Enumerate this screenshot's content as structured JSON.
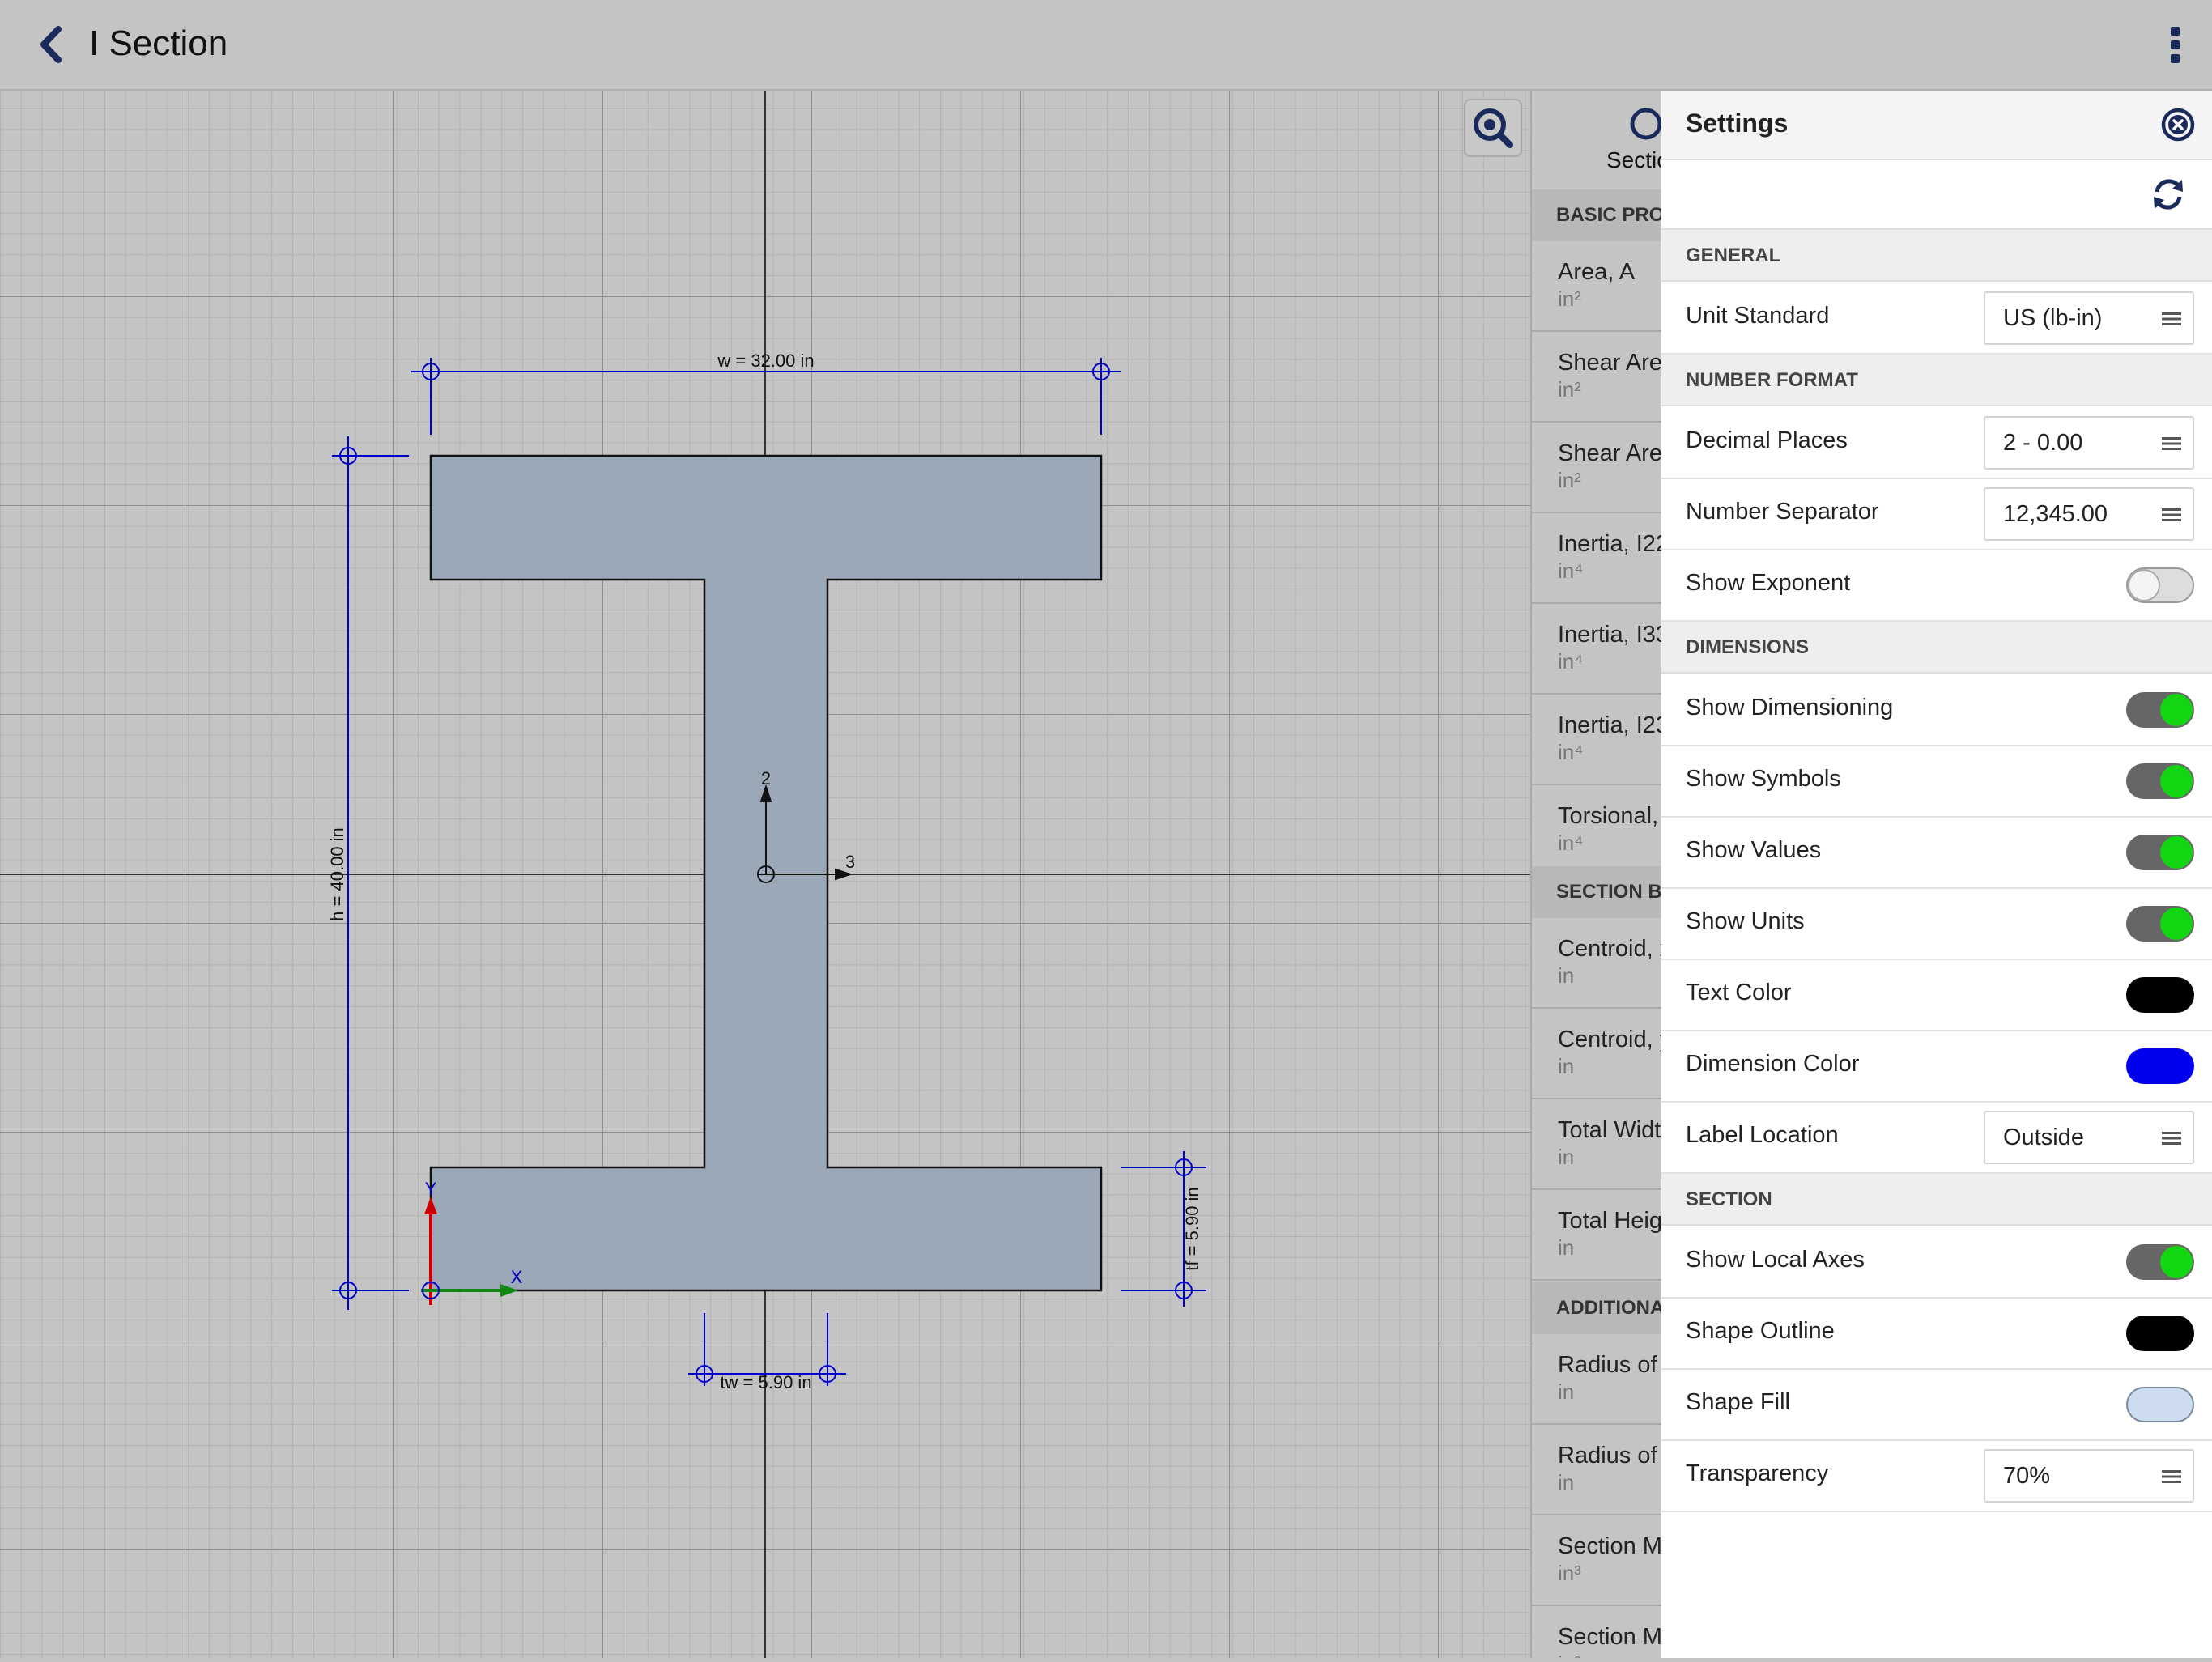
{
  "header": {
    "title": "I Section"
  },
  "section": {
    "w_label": "w = 32.00 in",
    "h_label": "h = 40.00 in",
    "tw_label": "tw = 5.90 in",
    "tf_label": "tf = 5.90 in",
    "axis_x": "X",
    "axis_y": "Y",
    "axis_2": "2",
    "axis_3": "3"
  },
  "properties": {
    "tab_label": "Section",
    "sections": [
      "BASIC PROPERTIES",
      "SECTION BOUNDS",
      "ADDITIONAL PROPERTIES"
    ],
    "rows": [
      {
        "label": "Area, A",
        "unit": "in²"
      },
      {
        "label": "Shear Area",
        "unit": "in²"
      },
      {
        "label": "Shear Area",
        "unit": "in²"
      },
      {
        "label": "Inertia, I22",
        "unit": "in⁴"
      },
      {
        "label": "Inertia, I33",
        "unit": "in⁴"
      },
      {
        "label": "Inertia, I23",
        "unit": "in⁴"
      },
      {
        "label": "Torsional, J",
        "unit": "in⁴"
      },
      {
        "label": "Centroid, x",
        "unit": "in"
      },
      {
        "label": "Centroid, y",
        "unit": "in"
      },
      {
        "label": "Total Width",
        "unit": "in"
      },
      {
        "label": "Total Height",
        "unit": "in"
      },
      {
        "label": "Radius of Gyration",
        "unit": "in"
      },
      {
        "label": "Radius of Gyration",
        "unit": "in"
      },
      {
        "label": "Section Modulus",
        "unit": "in³"
      },
      {
        "label": "Section Modulus",
        "unit": "in³"
      }
    ]
  },
  "settings": {
    "title": "Settings",
    "general": {
      "heading": "GENERAL",
      "unit_standard_label": "Unit Standard",
      "unit_standard_value": "US (lb-in)"
    },
    "number_format": {
      "heading": "NUMBER FORMAT",
      "decimal_places_label": "Decimal Places",
      "decimal_places_value": "2 - 0.00",
      "number_separator_label": "Number Separator",
      "number_separator_value": "12,345.00",
      "show_exponent_label": "Show Exponent",
      "show_exponent": false
    },
    "dimensions": {
      "heading": "DIMENSIONS",
      "show_dimensioning_label": "Show Dimensioning",
      "show_dimensioning": true,
      "show_symbols_label": "Show Symbols",
      "show_symbols": true,
      "show_values_label": "Show Values",
      "show_values": true,
      "show_units_label": "Show Units",
      "show_units": true,
      "text_color_label": "Text Color",
      "text_color": "#000000",
      "dimension_color_label": "Dimension Color",
      "dimension_color": "#0000ee",
      "label_location_label": "Label Location",
      "label_location_value": "Outside"
    },
    "section": {
      "heading": "SECTION",
      "show_local_axes_label": "Show Local Axes",
      "show_local_axes": true,
      "shape_outline_label": "Shape Outline",
      "shape_outline_color": "#000000",
      "shape_fill_label": "Shape Fill",
      "shape_fill_color": "#cddcef",
      "transparency_label": "Transparency",
      "transparency_value": "70%"
    }
  }
}
